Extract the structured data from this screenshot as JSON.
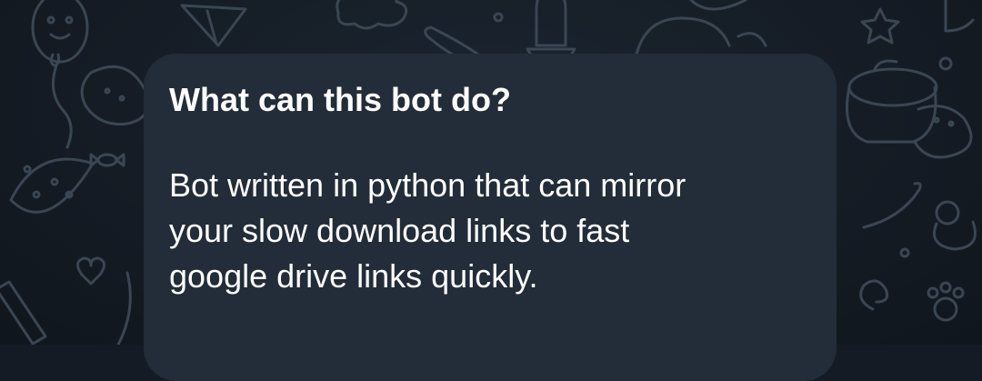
{
  "chat": {
    "background_color": "#141b24",
    "doodle_color": "#3a4653"
  },
  "bot_info": {
    "title": "What can this bot do?",
    "description_lines": [
      "Bot written in python that can mirror",
      "your slow download links to fast",
      "google drive links quickly."
    ],
    "bubble_color": "#222d39",
    "text_color": "#ffffff"
  }
}
